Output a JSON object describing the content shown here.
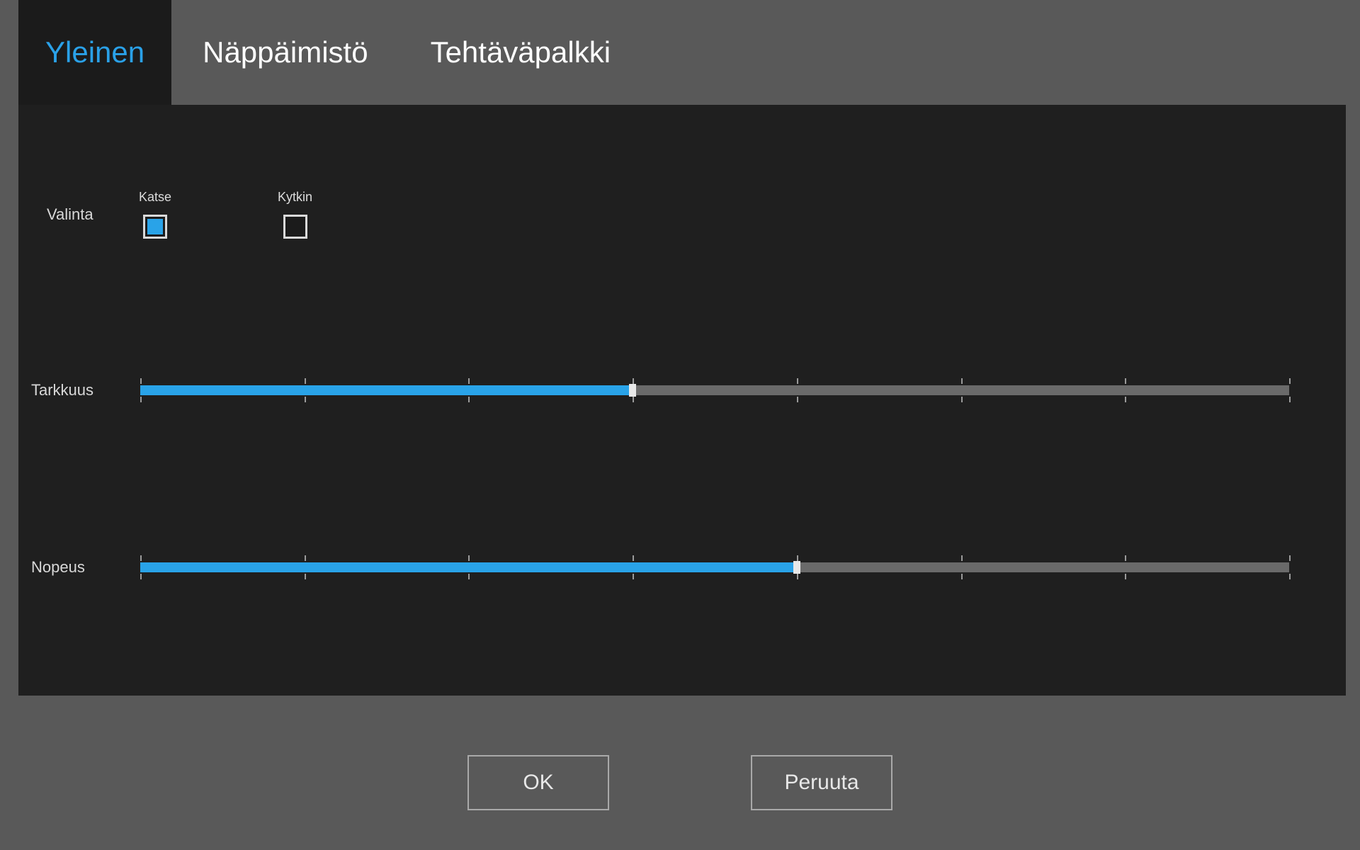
{
  "tabs": {
    "general": {
      "label": "Yleinen",
      "active": true
    },
    "keyboard": {
      "label": "Näppäimistö",
      "active": false
    },
    "taskbar": {
      "label": "Tehtäväpalkki",
      "active": false
    }
  },
  "selection": {
    "label": "Valinta",
    "options": {
      "gaze": {
        "label": "Katse",
        "checked": true
      },
      "switch": {
        "label": "Kytkin",
        "checked": false
      }
    }
  },
  "sliders": {
    "precision": {
      "label": "Tarkkuus",
      "value": 3,
      "min": 0,
      "max": 7
    },
    "speed": {
      "label": "Nopeus",
      "value": 4,
      "min": 0,
      "max": 7
    }
  },
  "buttons": {
    "ok": "OK",
    "cancel": "Peruuta"
  },
  "colors": {
    "accent": "#29a3e8",
    "panel": "#1f1f1f",
    "chrome": "#595959"
  }
}
